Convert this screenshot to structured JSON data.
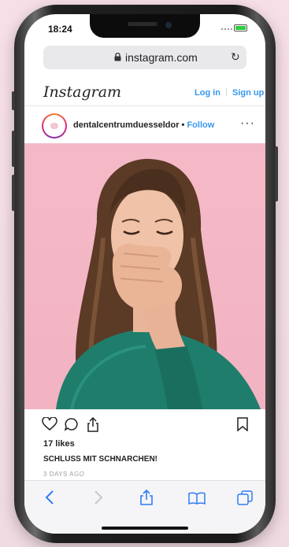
{
  "status": {
    "time": "18:24"
  },
  "browser": {
    "url": "instagram.com"
  },
  "instagram": {
    "logo": "Instagram",
    "login_label": "Log in",
    "separator": "|",
    "signup_label": "Sign up"
  },
  "post": {
    "username": "dentalcentrumduesseldor",
    "follow_label": "Follow",
    "bullet": " • ",
    "more_label": "···",
    "likes": "17 likes",
    "caption": "SCHLUSS MIT SCHNARCHEN!",
    "date": "3 DAYS AGO"
  },
  "icons": {
    "heart": "heart-icon",
    "comment": "comment-icon",
    "share": "share-icon",
    "bookmark": "bookmark-icon",
    "back": "back-chevron-icon",
    "forward": "forward-chevron-icon",
    "safari_share": "share-icon",
    "bookmarks": "book-icon",
    "tabs": "tabs-icon"
  },
  "colors": {
    "accent": "#3897f0",
    "photo_background": "#f4b9c7",
    "sweater": "#1f7d6b",
    "battery": "#2ecc40"
  }
}
